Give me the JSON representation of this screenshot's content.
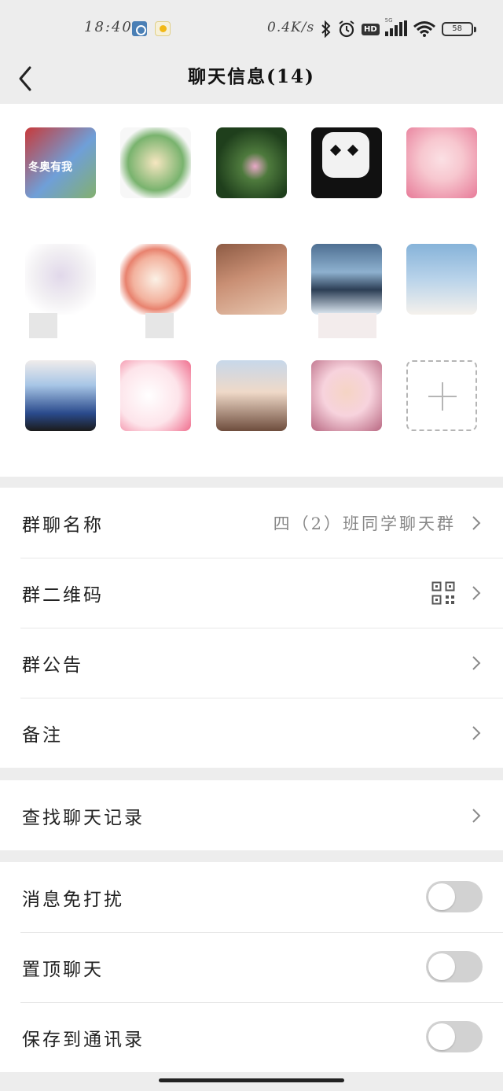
{
  "status_bar": {
    "time": "18:40",
    "speed": "0.4K/s",
    "hd": "HD",
    "net": "5G",
    "battery": "58"
  },
  "nav": {
    "title": "聊天信息(14)"
  },
  "members": {
    "count": 14,
    "avatars": [
      {
        "colors": [
          "#c83a3a",
          "#6f9fd8"
        ],
        "caption": "冬奥有我"
      },
      {
        "colors": [
          "#f6e6c0",
          "#79b36e"
        ]
      },
      {
        "colors": [
          "#1f3f1c",
          "#e9a9c8"
        ]
      },
      {
        "colors": [
          "#111111",
          "#f2f2f2"
        ]
      },
      {
        "colors": [
          "#f7c7cf",
          "#e77a98"
        ]
      },
      {
        "colors": [
          "#f2f0f3",
          "#b8a6c9"
        ]
      },
      {
        "colors": [
          "#fbf1e6",
          "#e8826e"
        ]
      },
      {
        "colors": [
          "#8d5b44",
          "#e8c7b0"
        ]
      },
      {
        "colors": [
          "#4e6f92",
          "#e1ecf5"
        ]
      },
      {
        "colors": [
          "#86b3d9",
          "#f5f1ec"
        ]
      },
      {
        "colors": [
          "#f0eceb",
          "#2a4a8c"
        ]
      },
      {
        "colors": [
          "#fde4ea",
          "#f06e8e"
        ]
      },
      {
        "colors": [
          "#c7d8ea",
          "#6e4d3d"
        ]
      },
      {
        "colors": [
          "#f7d3dd",
          "#b96882"
        ]
      }
    ]
  },
  "settings_group_1": {
    "group_name_label": "群聊名称",
    "group_name_value": "四（2）班同学聊天群",
    "qr_code_label": "群二维码",
    "announcement_label": "群公告",
    "remark_label": "备注"
  },
  "settings_group_2": {
    "search_history_label": "查找聊天记录"
  },
  "settings_group_3": {
    "mute_label": "消息免打扰",
    "mute_on": false,
    "pin_label": "置顶聊天",
    "pin_on": false,
    "save_contacts_label": "保存到通讯录",
    "save_contacts_on": false
  }
}
